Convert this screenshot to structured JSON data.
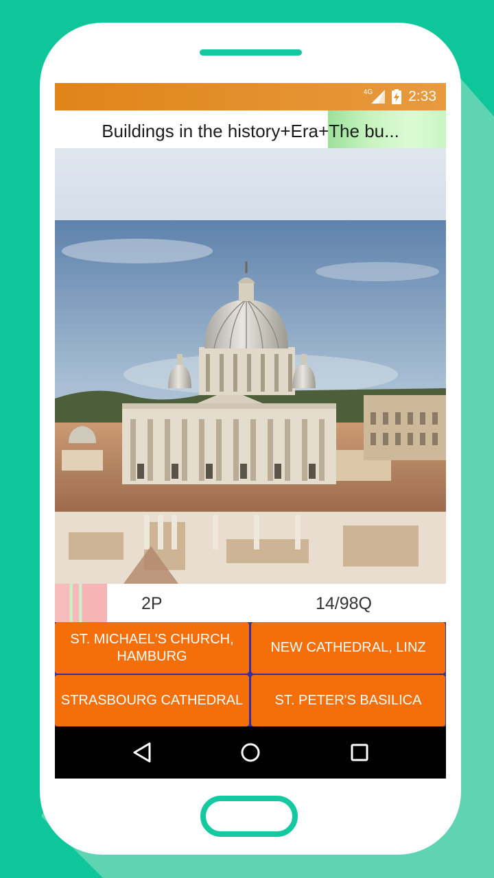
{
  "status": {
    "network": "4G",
    "time": "2:33"
  },
  "header": {
    "title": "Buildings in the history+Era+The bu..."
  },
  "image": {
    "subject": "photo-dome-basilica"
  },
  "info": {
    "score": "2P",
    "progress": "14/98Q"
  },
  "answers": [
    {
      "label": "ST. MICHAEL'S CHURCH, HAMBURG"
    },
    {
      "label": "NEW CATHEDRAL, LINZ"
    },
    {
      "label": "STRASBOURG CATHEDRAL"
    },
    {
      "label": "ST. PETER'S BASILICA"
    }
  ],
  "nav": {
    "back": "back-icon",
    "home": "home-icon",
    "recent": "recent-apps-icon"
  },
  "colors": {
    "background": "#0fc69b",
    "statusbar": "#e08418",
    "answer_button": "#f46f0a",
    "title_highlight": "#c7f3bf",
    "lives": "#f7bcbc"
  }
}
